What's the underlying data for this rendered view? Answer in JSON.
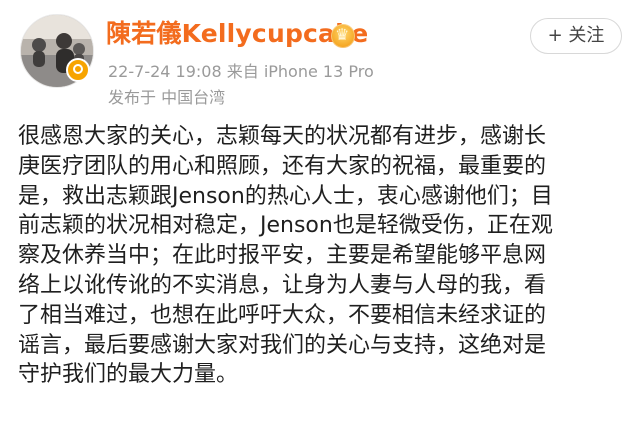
{
  "post": {
    "author": {
      "name": "陳若儀Kellycupcake"
    },
    "follow_button": "+ 关注",
    "meta": "22-7-24 19:08  来自 iPhone 13 Pro",
    "location": "发布于  中国台湾",
    "content_lines": [
      "很感恩大家的关心，志颖每天的状况都有进步，感谢长",
      "庚医疗团队的用心和照顾，还有大家的祝福，最重要的",
      "是，救出志颖跟Jenson的热心人士，衷心感谢他们；目",
      "前志颖的状况相对稳定，Jenson也是轻微受伤，正在观",
      "察及休养当中；在此时报平安，主要是希望能够平息网",
      "络上以讹传讹的不实消息，让身为人妻与人母的我，看",
      "了相当难过，也想在此呼吁大众，不要相信未经求证的",
      "谣言，最后要感谢大家对我们的关心与支持，这绝对是",
      "守护我们的最大力量。"
    ]
  },
  "colors": {
    "name": "#f36c1e",
    "meta": "#9a9a9a",
    "content": "#1f1f1f",
    "follow_border": "#d8d8d8",
    "badge": "#f7a400"
  },
  "icons": {
    "avatar": "avatar",
    "verify_badge": "verified-badge-icon",
    "crown": "crown-icon"
  }
}
